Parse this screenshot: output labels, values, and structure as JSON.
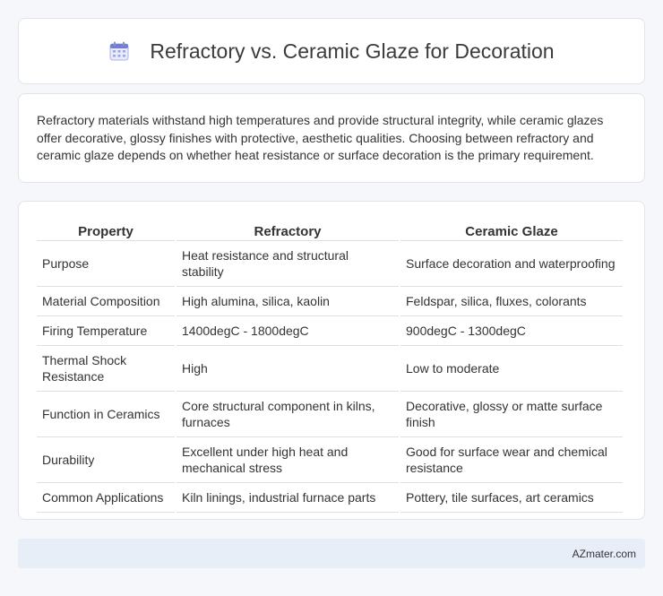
{
  "header": {
    "title": "Refractory vs. Ceramic Glaze for Decoration",
    "icon": "calendar-icon"
  },
  "intro": {
    "text": "Refractory materials withstand high temperatures and provide structural integrity, while ceramic glazes offer decorative, glossy finishes with protective, aesthetic qualities. Choosing between refractory and ceramic glaze depends on whether heat resistance or surface decoration is the primary requirement."
  },
  "table": {
    "headers": [
      "Property",
      "Refractory",
      "Ceramic Glaze"
    ],
    "rows": [
      [
        "Purpose",
        "Heat resistance and structural stability",
        "Surface decoration and waterproofing"
      ],
      [
        "Material Composition",
        "High alumina, silica, kaolin",
        "Feldspar, silica, fluxes, colorants"
      ],
      [
        "Firing Temperature",
        "1400degC - 1800degC",
        "900degC - 1300degC"
      ],
      [
        "Thermal Shock Resistance",
        "High",
        "Low to moderate"
      ],
      [
        "Function in Ceramics",
        "Core structural component in kilns, furnaces",
        "Decorative, glossy or matte surface finish"
      ],
      [
        "Durability",
        "Excellent under high heat and mechanical stress",
        "Good for surface wear and chemical resistance"
      ],
      [
        "Common Applications",
        "Kiln linings, industrial furnace parts",
        "Pottery, tile surfaces, art ceramics"
      ]
    ]
  },
  "footer": {
    "brand": "AZmater.com"
  }
}
